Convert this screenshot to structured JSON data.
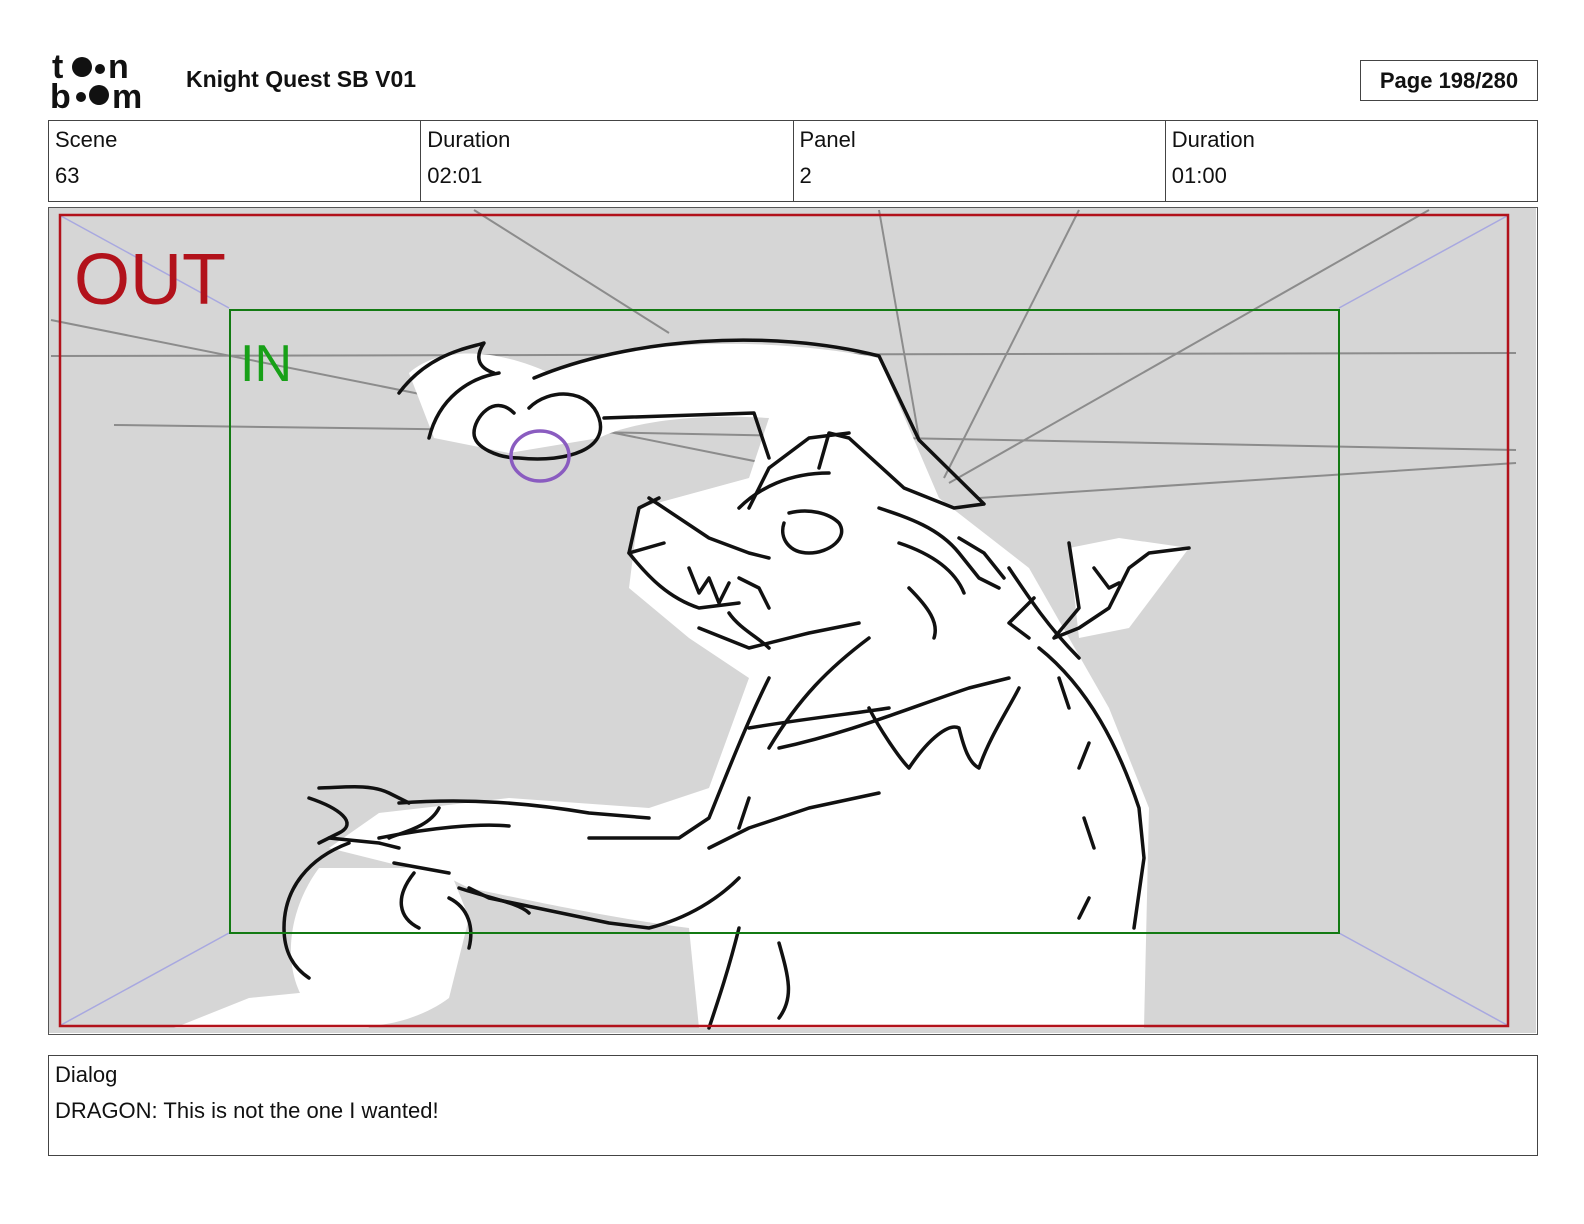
{
  "header": {
    "logo_text": "toon boom",
    "project_title": "Knight Quest SB V01",
    "page_indicator": "Page 198/280"
  },
  "info": [
    {
      "label": "Scene",
      "value": "63"
    },
    {
      "label": "Duration",
      "value": "02:01"
    },
    {
      "label": "Panel",
      "value": "2"
    },
    {
      "label": "Duration",
      "value": "01:00"
    }
  ],
  "panel": {
    "out_label": "OUT",
    "in_label": "IN",
    "colors": {
      "background": "#d6d6d6",
      "out_frame": "#b2121b",
      "in_frame": "#137a13",
      "perspective_lines": "#8c8c8c",
      "corner_lines": "#a8a8e0",
      "magic_ball": "#8a5cc0"
    }
  },
  "dialog": {
    "label": "Dialog",
    "text": "DRAGON: This is not the one I wanted!"
  }
}
